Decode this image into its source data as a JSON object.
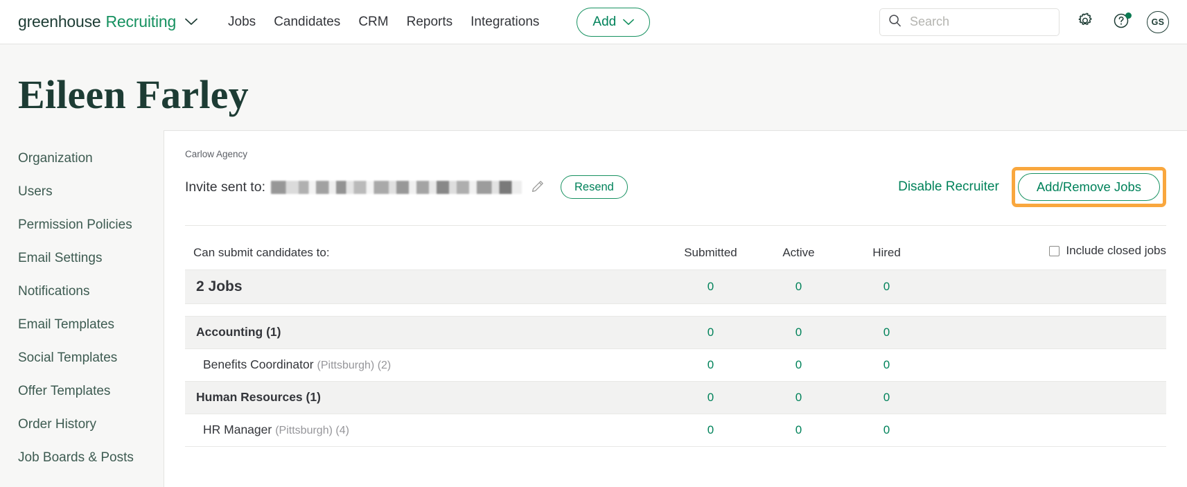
{
  "nav": {
    "brand_word_1": "greenhouse",
    "brand_word_2": "Recruiting",
    "links": [
      {
        "label": "Jobs"
      },
      {
        "label": "Candidates"
      },
      {
        "label": "CRM"
      },
      {
        "label": "Reports"
      },
      {
        "label": "Integrations"
      }
    ],
    "add_label": "Add",
    "search_placeholder": "Search",
    "search_value": "",
    "avatar_initials": "GS"
  },
  "page": {
    "title": "Eileen Farley"
  },
  "sidebar": {
    "items": [
      {
        "label": "Organization"
      },
      {
        "label": "Users"
      },
      {
        "label": "Permission Policies"
      },
      {
        "label": "Email Settings"
      },
      {
        "label": "Notifications"
      },
      {
        "label": "Email Templates"
      },
      {
        "label": "Social Templates"
      },
      {
        "label": "Offer Templates"
      },
      {
        "label": "Order History"
      },
      {
        "label": "Job Boards & Posts"
      }
    ]
  },
  "card": {
    "agency": "Carlow Agency",
    "invite_label": "Invite sent to:",
    "invite_email_redacted": "",
    "resend_label": "Resend",
    "disable_label": "Disable Recruiter",
    "add_remove_label": "Add/Remove Jobs"
  },
  "table": {
    "headers": {
      "name": "Can submit candidates to:",
      "submitted": "Submitted",
      "active": "Active",
      "hired": "Hired"
    },
    "include_closed_label": "Include closed jobs",
    "include_closed_checked": false,
    "rows": [
      {
        "kind": "total",
        "name": "2 Jobs",
        "submitted": "0",
        "active": "0",
        "hired": "0"
      },
      {
        "kind": "spacer"
      },
      {
        "kind": "group",
        "name": "Accounting (1)",
        "submitted": "0",
        "active": "0",
        "hired": "0"
      },
      {
        "kind": "job",
        "name": "Benefits Coordinator",
        "meta": "(Pittsburgh) (2)",
        "submitted": "0",
        "active": "0",
        "hired": "0"
      },
      {
        "kind": "group",
        "name": "Human Resources (1)",
        "submitted": "0",
        "active": "0",
        "hired": "0"
      },
      {
        "kind": "job",
        "name": "HR Manager",
        "meta": "(Pittsburgh) (4)",
        "submitted": "0",
        "active": "0",
        "hired": "0"
      }
    ]
  },
  "colors": {
    "brand_green": "#169160",
    "dark_green": "#1d3c34",
    "link_green": "#00825a",
    "highlight_orange": "#f9a73e",
    "row_gray": "#f2f2f1"
  }
}
